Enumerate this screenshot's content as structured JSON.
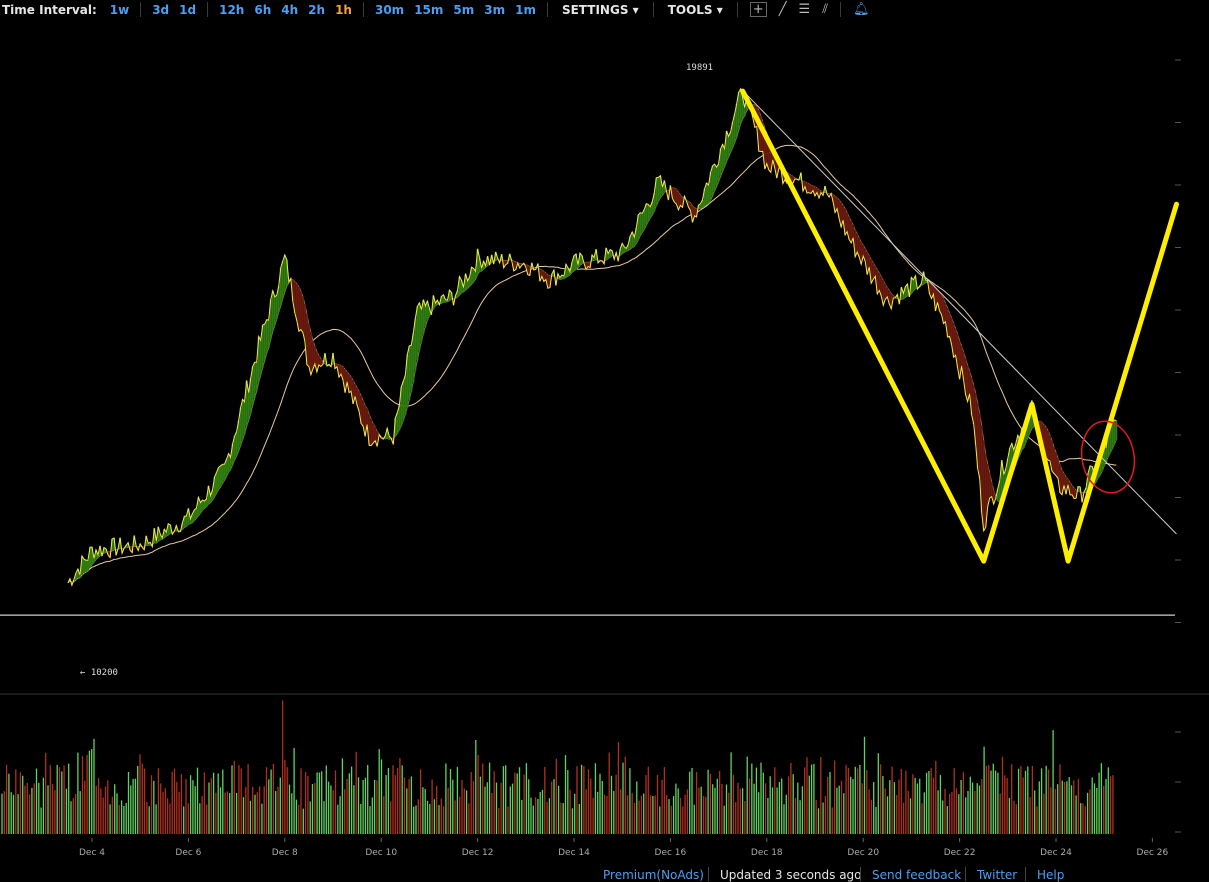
{
  "toolbar": {
    "time_interval_label": "Time Interval:",
    "intervals": [
      "1w",
      "3d",
      "1d",
      "12h",
      "6h",
      "4h",
      "2h",
      "1h",
      "30m",
      "15m",
      "5m",
      "3m",
      "1m"
    ],
    "active_interval": "1h",
    "settings_label": "SETTINGS",
    "tools_label": "TOOLS"
  },
  "chart_data": {
    "type": "line",
    "x": [
      "Dec 3 12:00",
      "Dec 4 00:00",
      "Dec 5 00:00",
      "Dec 6 00:00",
      "Dec 6 18:00",
      "Dec 7 12:00",
      "Dec 8 00:00",
      "Dec 8 12:00",
      "Dec 9 00:00",
      "Dec 9 18:00",
      "Dec 10 06:00",
      "Dec 10 18:00",
      "Dec 11 12:00",
      "Dec 12 00:00",
      "Dec 13 00:00",
      "Dec 13 12:00",
      "Dec 14 00:00",
      "Dec 15 00:00",
      "Dec 15 18:00",
      "Dec 16 12:00",
      "Dec 17 06:00",
      "Dec 17 12:00",
      "Dec 18 00:00",
      "Dec 18 12:00",
      "Dec 19 06:00",
      "Dec 19 18:00",
      "Dec 20 12:00",
      "Dec 21 06:00",
      "Dec 21 18:00",
      "Dec 22 06:00",
      "Dec 22 12:00",
      "Dec 23 00:00",
      "Dec 23 12:00",
      "Dec 24 00:00",
      "Dec 24 12:00",
      "Dec 25 00:00",
      "Dec 25 06:00"
    ],
    "close": [
      10800,
      11400,
      11500,
      12000,
      12900,
      15300,
      16800,
      14800,
      15000,
      13500,
      13500,
      15800,
      16100,
      16800,
      16700,
      16400,
      16700,
      16900,
      18200,
      17600,
      19300,
      19891,
      18500,
      18300,
      18000,
      17100,
      16000,
      16400,
      15500,
      14000,
      11900,
      13200,
      14000,
      12600,
      12400,
      13300,
      13800
    ],
    "volume_x": [
      "Dec 4",
      "Dec 8",
      "Dec 10",
      "Dec 12",
      "Dec 15",
      "Dec 18",
      "Dec 20",
      "Dec 22 12:00",
      "Dec 24",
      "Dec 25"
    ],
    "volume": [
      1.0,
      0.95,
      0.65,
      0.55,
      0.5,
      0.55,
      0.5,
      1.0,
      0.55,
      0.3
    ],
    "xtick_labels": [
      "Dec 4",
      "Dec 6",
      "Dec 8",
      "Dec 10",
      "Dec 12",
      "Dec 14",
      "Dec 16",
      "Dec 18",
      "Dec 20",
      "Dec 22",
      "Dec 24",
      "Dec 26"
    ],
    "annotations": {
      "high": "19891",
      "low": "← 10200",
      "low_value": 10200
    },
    "overlay_pattern": [
      [
        "Dec 17 12:00",
        19891
      ],
      [
        "Dec 22 12:00",
        11200
      ],
      [
        "Dec 23 12:00",
        14100
      ],
      [
        "Dec 24 06:00",
        11200
      ],
      [
        "Dec 26 12:00",
        17800
      ]
    ],
    "trendline": [
      [
        "Dec 17 12:00",
        19900
      ],
      [
        "Dec 26 12:00",
        11700
      ]
    ],
    "ylim": [
      9000,
      20800
    ],
    "colors": {
      "price": "#f2e84c",
      "up_fill": "#2f7d12",
      "down_fill": "#6a1a0e",
      "ma": "#e8c9a0",
      "pattern": "#ffee00",
      "circle": "#e01a1a",
      "trendline": "#cfcfcf",
      "vol_up": "#5fd35f",
      "vol_down": "#b03020"
    }
  },
  "footer": {
    "premium": "Premium(NoAds)",
    "updated": "Updated 3 seconds ago",
    "feedback": "Send feedback",
    "twitter": "Twitter",
    "help": "Help"
  }
}
